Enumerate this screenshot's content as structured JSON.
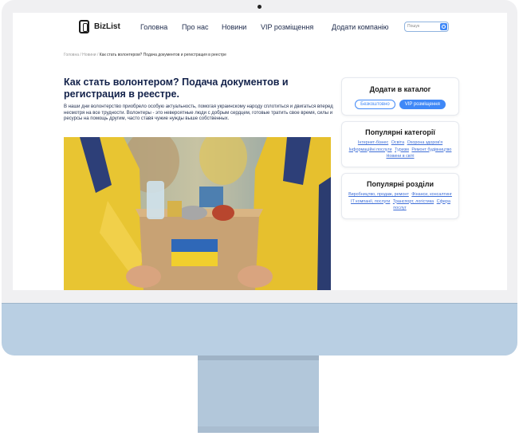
{
  "header": {
    "logo_text": "BizList",
    "nav": [
      "Головна",
      "Про нас",
      "Новини",
      "VIP розміщення",
      "Додати компанію"
    ],
    "search_placeholder": "Пошук"
  },
  "breadcrumb": {
    "items": [
      "Головна",
      "Новини"
    ],
    "separator": "/",
    "current": "Как стать волонтером? Подача документов и регистрация в реестре"
  },
  "article": {
    "title": "Как стать волонтером? Подача документов и регистрация в реестре.",
    "paragraph": "В наши дни волонтерство приобрело особую актуальность, помогая украинскому народу сплотиться и двигаться вперед несмотря на все трудности. Волонтеры - это невероятные люди с добрым сердцем, готовые тратить свое время, силы и ресурсы на помощь другим, часто ставя чужие нужды выше собственных."
  },
  "sidebar": {
    "catalog": {
      "title": "Додати в каталог",
      "free_label": "Безкоштовно",
      "vip_label": "VIP розміщення"
    },
    "categories": {
      "title": "Популярні категорії",
      "links": [
        "Інтернет-бізнес",
        "Освіта",
        "Охорона здоров'я",
        "Інформаційні послуги",
        "Туризм",
        "Ремонт будівництво",
        "Новини в світі"
      ]
    },
    "sections": {
      "title": "Популярні розділи",
      "links": [
        "Виробництво, продаж, ремонт",
        "Фінанси, консалтинг",
        "IT компанії, послуги",
        "Транспорт, логістика",
        "Сфера послуг"
      ]
    }
  },
  "colors": {
    "accent": "#3f88f7",
    "title": "#12214a",
    "monitor_chin": "#b9cfe3"
  },
  "icons": {
    "logo": "bizlist-logo-icon",
    "search": "search-icon"
  }
}
